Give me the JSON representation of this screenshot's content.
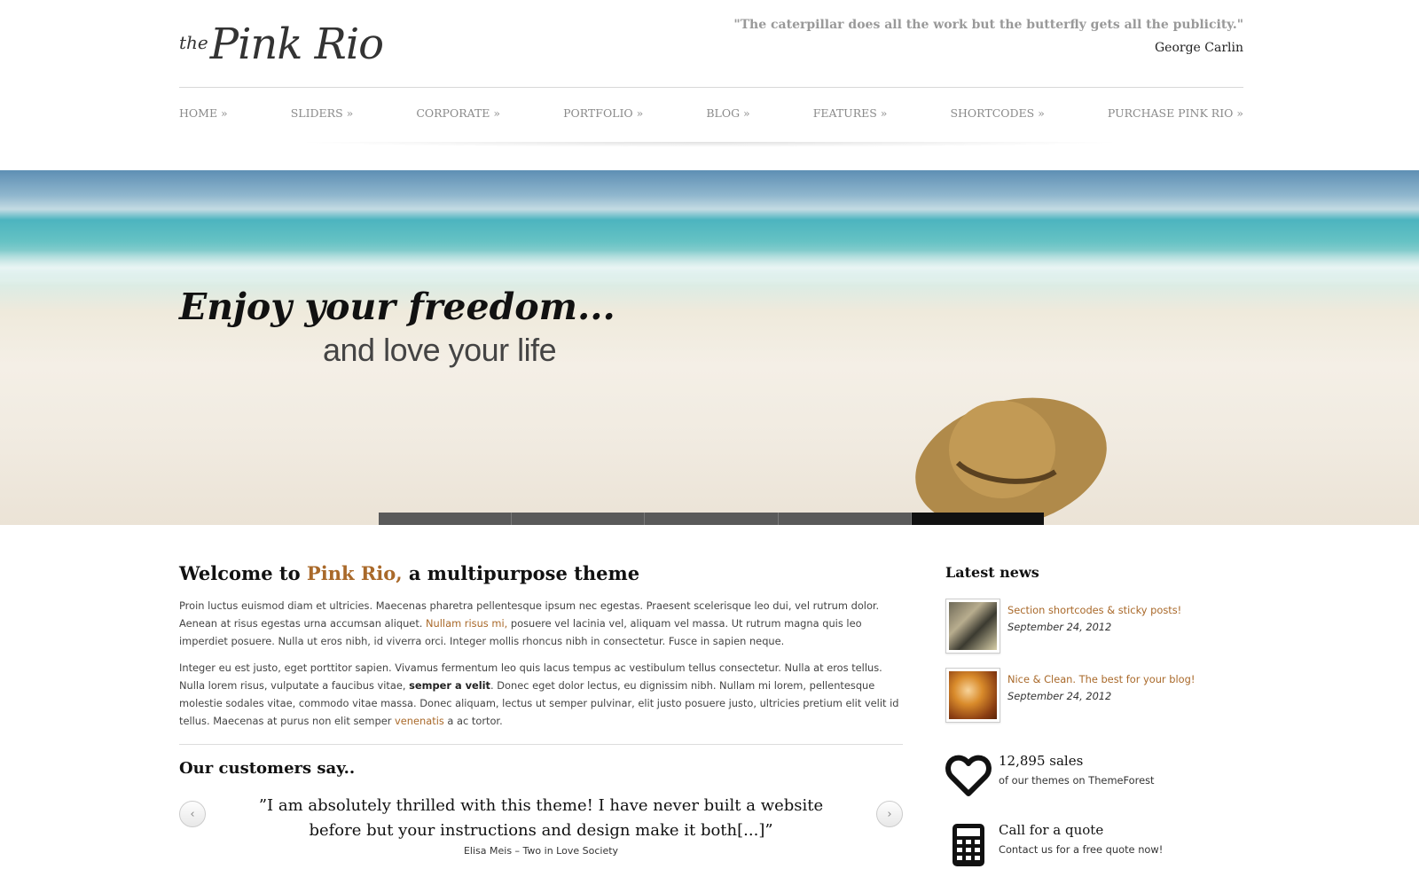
{
  "brand": {
    "logo_prefix": "the",
    "logo_name": "Pink Rio"
  },
  "header_quote": {
    "text": "\"The caterpillar does all the work but the butterfly gets all the publicity.\"",
    "author": "George Carlin"
  },
  "nav": {
    "items": [
      {
        "label": "HOME »"
      },
      {
        "label": "SLIDERS »"
      },
      {
        "label": "CORPORATE »"
      },
      {
        "label": "PORTFOLIO »"
      },
      {
        "label": "BLOG »"
      },
      {
        "label": "FEATURES »"
      },
      {
        "label": "SHORTCODES »"
      },
      {
        "label": "PURCHASE PINK RIO »"
      }
    ]
  },
  "hero": {
    "headline": "Enjoy your freedom...",
    "subheadline": "and love your life",
    "slides_count": 5,
    "active_slide": 5
  },
  "welcome": {
    "prefix": "Welcome to ",
    "accent": "Pink Rio,",
    "suffix": " a multipurpose theme"
  },
  "paragraph1": {
    "before": "Proin luctus euismod diam et ultricies. Maecenas pharetra pellentesque ipsum nec egestas. Praesent scelerisque leo dui, vel rutrum dolor. Aenean at risus egestas urna accumsan aliquet. ",
    "link": "Nullam risus mi,",
    "after": " posuere vel lacinia vel, aliquam vel massa. Ut rutrum magna quis leo imperdiet posuere. Nulla ut eros nibh, id viverra orci. Integer mollis rhoncus nibh in consectetur. Fusce in sapien neque."
  },
  "paragraph2": {
    "before": "Integer eu est justo, eget porttitor sapien. Vivamus fermentum leo quis lacus tempus ac vestibulum tellus consectetur. Nulla at eros tellus. Nulla lorem risus, vulputate a faucibus vitae, ",
    "bold": "semper a velit",
    "middle": ". Donec eget dolor lectus, eu dignissim nibh. Nullam mi lorem, pellentesque molestie sodales vitae, commodo vitae massa. Donec aliquam, lectus ut semper pulvinar, elit justo posuere justo, ultricies pretium elit velit id tellus. Maecenas at purus non elit semper ",
    "link": "venenatis",
    "after": " a ac tortor."
  },
  "customers": {
    "title": "Our customers say..",
    "quote": "”I am absolutely thrilled with this theme! I have never built a website before but your instructions and design make it both[...]”",
    "author": "Elisa Meis – Two in Love Society"
  },
  "sidebar": {
    "news_title": "Latest news",
    "news": [
      {
        "title": "Section shortcodes & sticky posts!",
        "date": "September 24, 2012"
      },
      {
        "title": "Nice & Clean. The best for your blog!",
        "date": "September 24, 2012"
      }
    ],
    "sales": {
      "title": "12,895 sales",
      "subtitle": "of our themes on ThemeForest"
    },
    "quote_cta": {
      "title": "Call for a quote",
      "subtitle": "Contact us for a free quote now!"
    }
  },
  "colors": {
    "accent": "#a9692a",
    "nav_text": "#8a8a8a",
    "slider_active": "#111111",
    "slider_inactive": "#5a5a5a"
  }
}
